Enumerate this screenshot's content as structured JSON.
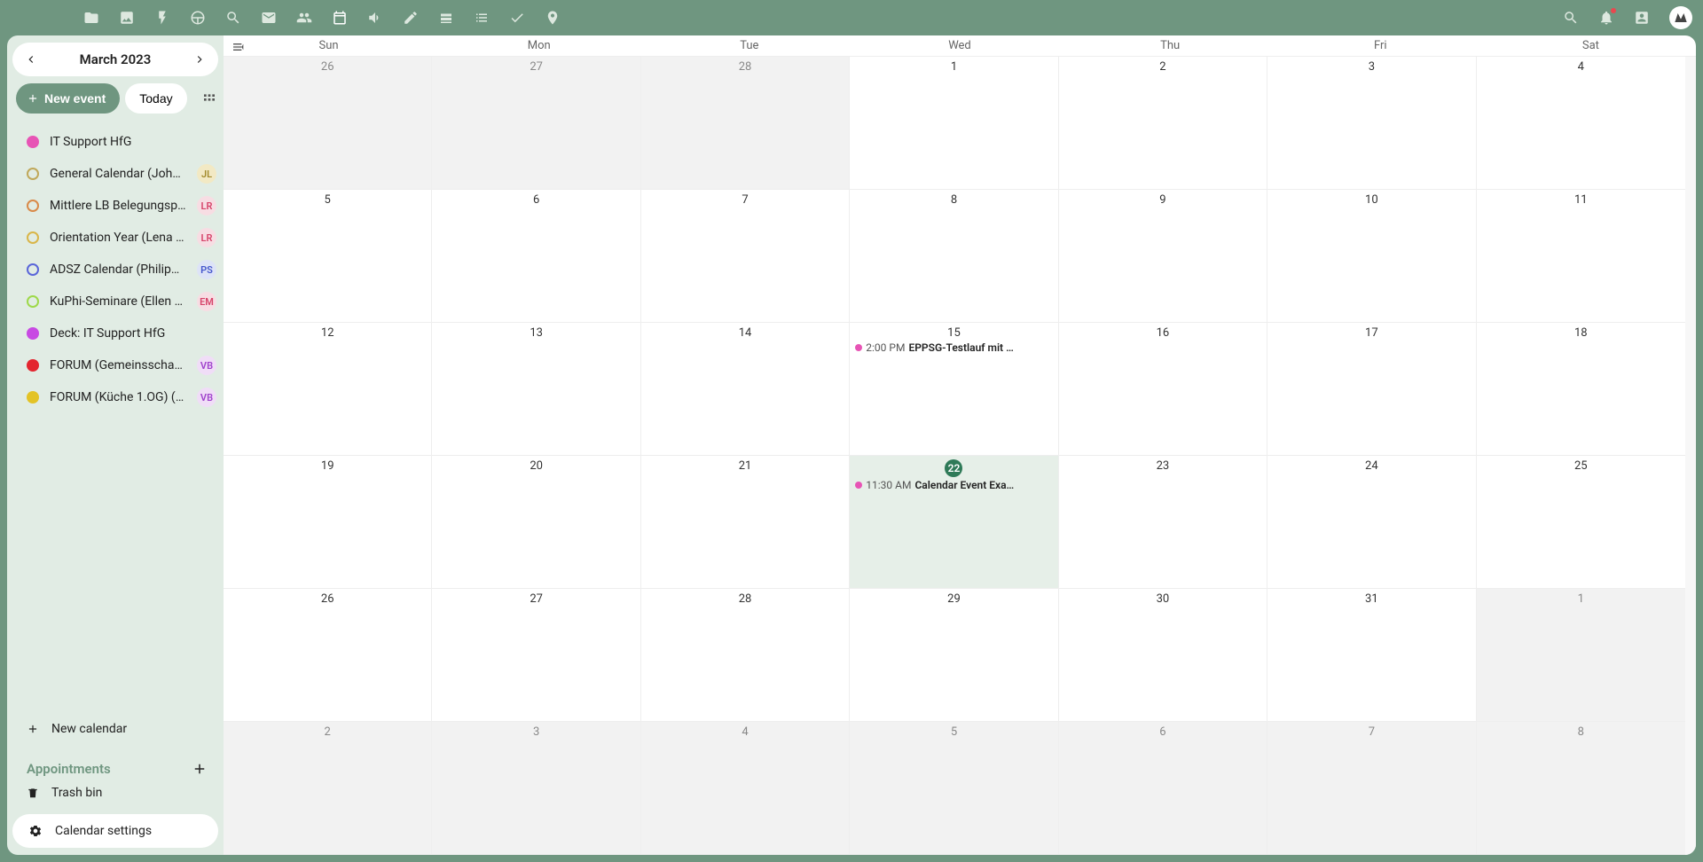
{
  "header": {
    "month_title": "March 2023",
    "new_event_label": "New event",
    "today_label": "Today"
  },
  "sidebar": {
    "calendars": [
      {
        "name": "IT Support HfG",
        "color": "#e754b5",
        "filled": true,
        "share": null
      },
      {
        "name": "General Calendar (Joha…",
        "color": "#c0a85a",
        "filled": false,
        "share": {
          "txt": "JL",
          "bg": "#f2e9c4",
          "fg": "#a38b2d"
        }
      },
      {
        "name": "Mittlere LB Belegungspl…",
        "color": "#d98a49",
        "filled": false,
        "share": {
          "txt": "LR",
          "bg": "#f7dde3",
          "fg": "#d6446a"
        }
      },
      {
        "name": "Orientation Year (Lena R…",
        "color": "#d9b649",
        "filled": false,
        "share": {
          "txt": "LR",
          "bg": "#f7dde3",
          "fg": "#d6446a"
        }
      },
      {
        "name": "ADSZ Calendar (Philipp …",
        "color": "#5a66d9",
        "filled": false,
        "share": {
          "txt": "PS",
          "bg": "#dde3f7",
          "fg": "#4456cc"
        }
      },
      {
        "name": "KuPhi-Seminare (Ellen M…",
        "color": "#9ed94a",
        "filled": false,
        "share": {
          "txt": "EM",
          "bg": "#f7dde3",
          "fg": "#d6446a"
        }
      },
      {
        "name": "Deck: IT Support HfG",
        "color": "#c84ae3",
        "filled": true,
        "share": null
      },
      {
        "name": "FORUM (Gemeinsschaft…",
        "color": "#e3262f",
        "filled": true,
        "share": {
          "txt": "VB",
          "bg": "#f0ddf7",
          "fg": "#a044cc"
        }
      },
      {
        "name": "FORUM (Küche 1.OG) (V…",
        "color": "#e3c326",
        "filled": true,
        "share": {
          "txt": "VB",
          "bg": "#f0ddf7",
          "fg": "#a044cc"
        }
      }
    ],
    "new_calendar_label": "New calendar",
    "appointments_label": "Appointments",
    "trash_label": "Trash bin",
    "settings_label": "Calendar settings"
  },
  "dayLabels": [
    "Sun",
    "Mon",
    "Tue",
    "Wed",
    "Thu",
    "Fri",
    "Sat"
  ],
  "cells": [
    {
      "n": "26",
      "outside": true
    },
    {
      "n": "27",
      "outside": true
    },
    {
      "n": "28",
      "outside": true
    },
    {
      "n": "1"
    },
    {
      "n": "2"
    },
    {
      "n": "3"
    },
    {
      "n": "4"
    },
    {
      "n": "5"
    },
    {
      "n": "6"
    },
    {
      "n": "7"
    },
    {
      "n": "8"
    },
    {
      "n": "9"
    },
    {
      "n": "10"
    },
    {
      "n": "11"
    },
    {
      "n": "12"
    },
    {
      "n": "13"
    },
    {
      "n": "14"
    },
    {
      "n": "15",
      "events": [
        {
          "color": "#e754b5",
          "time": "2:00 PM",
          "title": "EPPSG-Testlauf mit …"
        }
      ]
    },
    {
      "n": "16"
    },
    {
      "n": "17"
    },
    {
      "n": "18"
    },
    {
      "n": "19"
    },
    {
      "n": "20"
    },
    {
      "n": "21"
    },
    {
      "n": "22",
      "today": true,
      "events": [
        {
          "color": "#e754b5",
          "time": "11:30 AM",
          "title": "Calendar Event Exa…"
        }
      ]
    },
    {
      "n": "23"
    },
    {
      "n": "24"
    },
    {
      "n": "25"
    },
    {
      "n": "26"
    },
    {
      "n": "27"
    },
    {
      "n": "28"
    },
    {
      "n": "29"
    },
    {
      "n": "30"
    },
    {
      "n": "31"
    },
    {
      "n": "1",
      "outside": true
    },
    {
      "n": "2",
      "outside": true
    },
    {
      "n": "3",
      "outside": true
    },
    {
      "n": "4",
      "outside": true
    },
    {
      "n": "5",
      "outside": true
    },
    {
      "n": "6",
      "outside": true
    },
    {
      "n": "7",
      "outside": true
    },
    {
      "n": "8",
      "outside": true
    }
  ]
}
